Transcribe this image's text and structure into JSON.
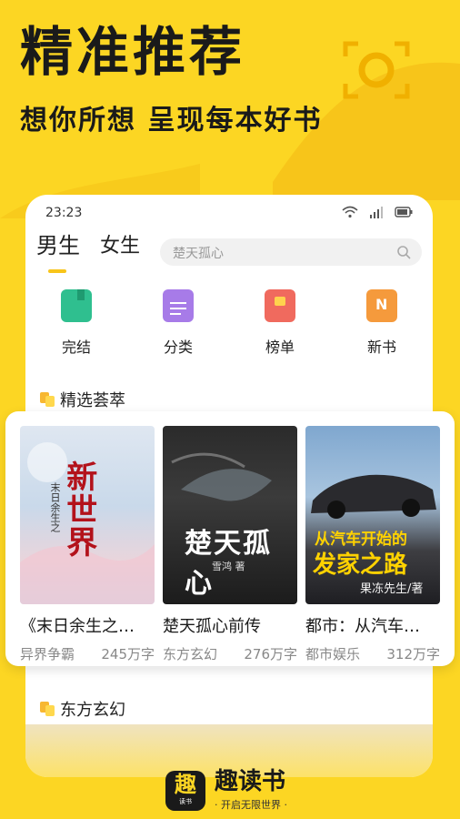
{
  "promo": {
    "headline": "精准推荐",
    "subline": "想你所想 呈现每本好书"
  },
  "status_bar": {
    "time": "23:23",
    "icons": [
      "wifi-icon",
      "signal-icon",
      "battery-icon"
    ]
  },
  "tabs": [
    {
      "label": "男生",
      "active": true
    },
    {
      "label": "女生",
      "active": false
    }
  ],
  "search": {
    "placeholder": "楚天孤心"
  },
  "categories": [
    {
      "label": "完结",
      "icon": "book-icon",
      "color": "#2fbf8f"
    },
    {
      "label": "分类",
      "icon": "document-icon",
      "color": "#a77be8"
    },
    {
      "label": "榜单",
      "icon": "ranking-icon",
      "color": "#f06a5e"
    },
    {
      "label": "新书",
      "icon": "new-book-icon",
      "color": "#f59a3c"
    }
  ],
  "sections": {
    "featured": "精选荟萃",
    "eastern_fantasy": "东方玄幻"
  },
  "books": [
    {
      "title": "《末日余生之…",
      "genre": "异界争霸",
      "words": "245万字",
      "cover_text": "新世界",
      "cover_subtext": "末日余生之"
    },
    {
      "title": "楚天孤心前传",
      "genre": "东方玄幻",
      "words": "276万字",
      "cover_text": "楚天孤心",
      "cover_author": "雪鸿 著"
    },
    {
      "title": "都市：从汽车…",
      "genre": "都市娱乐",
      "words": "312万字",
      "cover_text_a": "从汽车开始的",
      "cover_text_b": "发家之路",
      "cover_author": "果冻先生/著"
    }
  ],
  "brand": {
    "logo_main": "趣",
    "logo_sub": "读书",
    "name": "趣读书",
    "slogan": "· 开启无限世界 ·"
  },
  "colors": {
    "background": "#fcd623",
    "accent": "#f8c51a"
  }
}
